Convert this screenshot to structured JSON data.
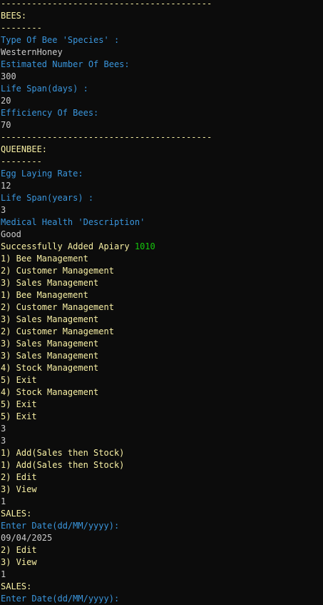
{
  "colors": {
    "background": "#0c0c0c",
    "yellow": "#f9f1a5",
    "cyan": "#3a96dd",
    "white": "#cccccc",
    "green": "#16c60c"
  },
  "lines": [
    {
      "text": "-----------------------------------------",
      "color": "yellow"
    },
    {
      "text": "BEES:",
      "color": "yellow"
    },
    {
      "text": "--------",
      "color": "yellow"
    },
    {
      "text": "Type Of Bee 'Species' :",
      "color": "cyan"
    },
    {
      "text": "WesternHoney",
      "color": "white"
    },
    {
      "text": "Estimated Number Of Bees:",
      "color": "cyan"
    },
    {
      "text": "300",
      "color": "white"
    },
    {
      "text": "Life Span(days) :",
      "color": "cyan"
    },
    {
      "text": "20",
      "color": "white"
    },
    {
      "text": "Efficiency Of Bees:",
      "color": "cyan"
    },
    {
      "text": "70",
      "color": "white"
    },
    {
      "text": "-----------------------------------------",
      "color": "yellow"
    },
    {
      "text": "QUEENBEE:",
      "color": "yellow"
    },
    {
      "text": "--------",
      "color": "yellow"
    },
    {
      "text": "Egg Laying Rate:",
      "color": "cyan"
    },
    {
      "text": "12",
      "color": "white"
    },
    {
      "text": "Life Span(years) :",
      "color": "cyan"
    },
    {
      "text": "3",
      "color": "white"
    },
    {
      "text": "Medical Health 'Description'",
      "color": "cyan"
    },
    {
      "text": "Good",
      "color": "white"
    },
    {
      "text": "Successfully Added Apiary ",
      "color": "yellow",
      "suffix": "1010",
      "suffix_color": "green"
    },
    {
      "text": "1) Bee Management",
      "color": "yellow"
    },
    {
      "text": "2) Customer Management",
      "color": "yellow"
    },
    {
      "text": "3) Sales Management",
      "color": "yellow"
    },
    {
      "text": "1) Bee Management",
      "color": "yellow"
    },
    {
      "text": "2) Customer Management",
      "color": "yellow"
    },
    {
      "text": "3) Sales Management",
      "color": "yellow"
    },
    {
      "text": "2) Customer Management",
      "color": "yellow"
    },
    {
      "text": "3) Sales Management",
      "color": "yellow"
    },
    {
      "text": "3) Sales Management",
      "color": "yellow"
    },
    {
      "text": "4) Stock Management",
      "color": "yellow"
    },
    {
      "text": "5) Exit",
      "color": "yellow"
    },
    {
      "text": "4) Stock Management",
      "color": "yellow"
    },
    {
      "text": "5) Exit",
      "color": "yellow"
    },
    {
      "text": "5) Exit",
      "color": "yellow"
    },
    {
      "text": "3",
      "color": "white"
    },
    {
      "text": "3",
      "color": "white"
    },
    {
      "text": "1) Add(Sales then Stock)",
      "color": "yellow"
    },
    {
      "text": "1) Add(Sales then Stock)",
      "color": "yellow"
    },
    {
      "text": "2) Edit",
      "color": "yellow"
    },
    {
      "text": "3) View",
      "color": "yellow"
    },
    {
      "text": "1",
      "color": "white"
    },
    {
      "text": "SALES:",
      "color": "yellow"
    },
    {
      "text": "Enter Date(dd/MM/yyyy):",
      "color": "cyan"
    },
    {
      "text": "09/04/2025",
      "color": "white"
    },
    {
      "text": "2) Edit",
      "color": "yellow"
    },
    {
      "text": "3) View",
      "color": "yellow"
    },
    {
      "text": "1",
      "color": "white"
    },
    {
      "text": "SALES:",
      "color": "yellow"
    },
    {
      "text": "Enter Date(dd/MM/yyyy):",
      "color": "cyan"
    }
  ]
}
